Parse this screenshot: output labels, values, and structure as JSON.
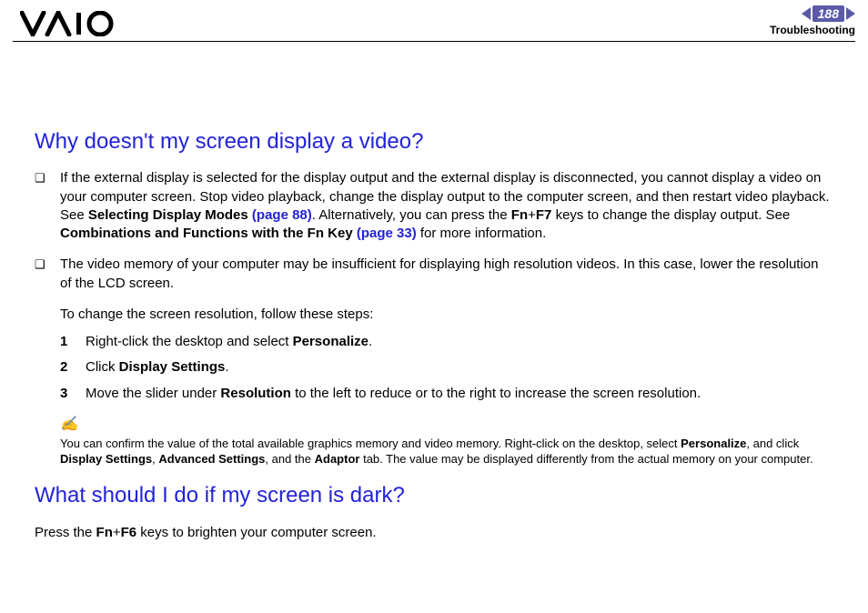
{
  "header": {
    "page_number": "188",
    "section": "Troubleshooting"
  },
  "heading1": "Why doesn't my screen display a video?",
  "bullets": [
    {
      "pre": "If the external display is selected for the display output and the external display is disconnected, you cannot display a video on your computer screen. Stop video playback, change the display output to the computer screen, and then restart video playback. See ",
      "bold1": "Selecting Display Modes ",
      "link1": "(page 88)",
      "mid1": ". Alternatively, you can press the ",
      "bold2": "Fn",
      "plus1": "+",
      "bold3": "F7",
      "mid2": " keys to change the display output. See ",
      "bold4": "Combinations and Functions with the Fn Key ",
      "link2": "(page 33)",
      "post": " for more information."
    },
    {
      "text": "The video memory of your computer may be insufficient for displaying high resolution videos. In this case, lower the resolution of the LCD screen."
    }
  ],
  "steps_intro": "To change the screen resolution, follow these steps:",
  "steps": [
    {
      "num": "1",
      "pre": "Right-click the desktop and select ",
      "bold": "Personalize",
      "post": "."
    },
    {
      "num": "2",
      "pre": "Click ",
      "bold": "Display Settings",
      "post": "."
    },
    {
      "num": "3",
      "pre": "Move the slider under ",
      "bold": "Resolution",
      "post": " to the left to reduce or to the right to increase the screen resolution."
    }
  ],
  "note": {
    "icon": "✍",
    "pre": "You can confirm the value of the total available graphics memory and video memory. Right-click on the desktop, select ",
    "b1": "Personalize",
    "m1": ", and click ",
    "b2": "Display Settings",
    "m2": ", ",
    "b3": "Advanced Settings",
    "m3": ", and the ",
    "b4": "Adaptor",
    "post": " tab. The value may be displayed differently from the actual memory on your computer."
  },
  "heading2": "What should I do if my screen is dark?",
  "para2": {
    "pre": "Press the ",
    "b1": "Fn",
    "plus": "+",
    "b2": "F6",
    "post": " keys to brighten your computer screen."
  }
}
